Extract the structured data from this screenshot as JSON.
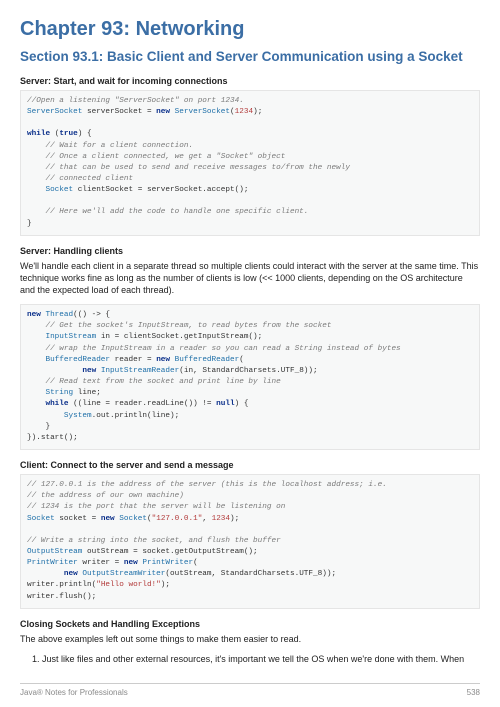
{
  "chapter": "Chapter 93: Networking",
  "section": "Section 93.1: Basic Client and Server Communication using a Socket",
  "sub1": "Server: Start, and wait for incoming connections",
  "code1": {
    "l1_open": "//Open a listening \"ServerSocket\" on port 1234.",
    "l2_a": "ServerSocket",
    "l2_b": " serverSocket = ",
    "l2_c": "new",
    "l2_d": " ServerSocket",
    "l2_e": "(",
    "l2_f": "1234",
    "l2_g": ");",
    "l3_a": "while",
    "l3_b": " (",
    "l3_c": "true",
    "l3_d": ") {",
    "l4": "    // Wait for a client connection.",
    "l5": "    // Once a client connected, we get a \"Socket\" object",
    "l6": "    // that can be used to send and receive messages to/from the newly",
    "l7": "    // connected client",
    "l8_a": "    ",
    "l8_b": "Socket",
    "l8_c": " clientSocket = serverSocket.accept();",
    "l9": "    // Here we'll add the code to handle one specific client.",
    "l10": "}"
  },
  "sub2": "Server: Handling clients",
  "para2": "We'll handle each client in a separate thread so multiple clients could interact with the server at the same time. This technique works fine as long as the number of clients is low (<< 1000 clients, depending on the OS architecture and the expected load of each thread).",
  "code2": {
    "l1_a": "new",
    "l1_b": " Thread",
    "l1_c": "(() -> {",
    "l2": "    // Get the socket's InputStream, to read bytes from the socket",
    "l3_a": "    ",
    "l3_b": "InputStream",
    "l3_c": " in = clientSocket.getInputStream();",
    "l4": "    // wrap the InputStream in a reader so you can read a String instead of bytes",
    "l5_a": "    ",
    "l5_b": "BufferedReader",
    "l5_c": " reader = ",
    "l5_d": "new",
    "l5_e": " BufferedReader",
    "l5_f": "(",
    "l6_a": "            ",
    "l6_b": "new",
    "l6_c": " InputStreamReader",
    "l6_d": "(in, StandardCharsets.UTF_8));",
    "l7": "    // Read text from the socket and print line by line",
    "l8_a": "    ",
    "l8_b": "String",
    "l8_c": " line;",
    "l9_a": "    ",
    "l9_b": "while",
    "l9_c": " ((line = reader.readLine()) != ",
    "l9_d": "null",
    "l9_e": ") {",
    "l10_a": "        ",
    "l10_b": "System",
    "l10_c": ".out.println(line);",
    "l11": "    }",
    "l12": "}).start();"
  },
  "sub3": "Client: Connect to the server and send a message",
  "code3": {
    "l1": "// 127.0.0.1 is the address of the server (this is the localhost address; i.e.",
    "l2": "// the address of our own machine)",
    "l3": "// 1234 is the port that the server will be listening on",
    "l4_a": "Socket",
    "l4_b": " socket = ",
    "l4_c": "new",
    "l4_d": " Socket",
    "l4_e": "(",
    "l4_f": "\"127.0.0.1\"",
    "l4_g": ", ",
    "l4_h": "1234",
    "l4_i": ");",
    "l5": "// Write a string into the socket, and flush the buffer",
    "l6_a": "OutputStream",
    "l6_b": " outStream = socket.getOutputStream();",
    "l7_a": "PrintWriter",
    "l7_b": " writer = ",
    "l7_c": "new",
    "l7_d": " PrintWriter",
    "l7_e": "(",
    "l8_a": "        ",
    "l8_b": "new",
    "l8_c": " OutputStreamWriter",
    "l8_d": "(outStream, StandardCharsets.UTF_8));",
    "l9_a": "writer.println(",
    "l9_b": "\"Hello world!\"",
    "l9_c": ");",
    "l10": "writer.flush();"
  },
  "sub4": "Closing Sockets and Handling Exceptions",
  "para4": "The above examples left out some things to make them easier to read.",
  "list_item1": "Just like files and other external resources, it's important we tell the OS when we're done with them. When",
  "footer_left": "Java® Notes for Professionals",
  "footer_right": "538"
}
